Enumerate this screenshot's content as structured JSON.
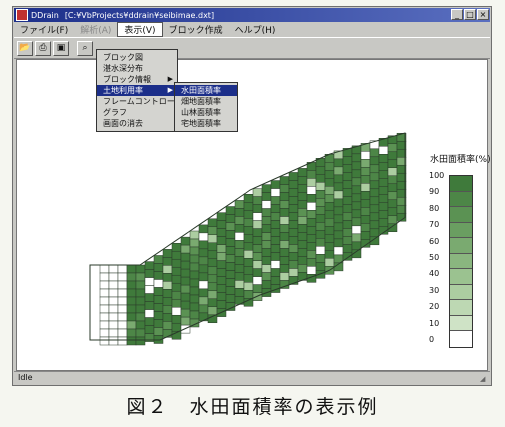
{
  "window": {
    "title_app": "DDrain",
    "title_path": "[C:¥VbProjects¥ddrain¥seibimae.dxt]",
    "controls": [
      "_",
      "□",
      "×"
    ]
  },
  "menubar": [
    {
      "label": "ファイル(F)",
      "state": "normal"
    },
    {
      "label": "解析(A)",
      "state": "dim"
    },
    {
      "label": "表示(V)",
      "state": "open"
    },
    {
      "label": "ブロック作成",
      "state": "normal"
    },
    {
      "label": "ヘルプ(H)",
      "state": "normal"
    }
  ],
  "toolbar": {
    "icons": [
      "open-folder-icon",
      "print-icon",
      "print-preview-icon",
      "zoom-icon"
    ]
  },
  "view_menu": {
    "items": [
      {
        "label": "ブロック図",
        "submenu": false
      },
      {
        "label": "湛水深分布",
        "submenu": false
      },
      {
        "label": "ブロック情報",
        "submenu": true
      },
      {
        "label": "土地利用率",
        "submenu": true,
        "selected": true
      },
      {
        "label": "フレームコントロール",
        "submenu": false
      },
      {
        "label": "グラフ",
        "submenu": false
      },
      {
        "label": "画面の消去",
        "submenu": false
      }
    ]
  },
  "landuse_submenu": {
    "items": [
      {
        "label": "水田面積率",
        "selected": true
      },
      {
        "label": "畑地面積率"
      },
      {
        "label": "山林面積率"
      },
      {
        "label": "宅地面積率"
      }
    ]
  },
  "legend": {
    "title": "水田面積率(%)",
    "labels": [
      "100",
      "90",
      "80",
      "70",
      "60",
      "50",
      "40",
      "30",
      "20",
      "10",
      "0"
    ],
    "colors": [
      "#3f7a3b",
      "#4d8647",
      "#5b9253",
      "#6a9e61",
      "#7aaa70",
      "#8ab67f",
      "#9bc290",
      "#accda1",
      "#bdd8b3",
      "#cfe3c6",
      "#ffffff"
    ]
  },
  "status": {
    "text": "Idle"
  },
  "caption": "図２　水田面積率の表示例",
  "colors": {
    "titlebar": "#1c2f8a",
    "map_outline": "#2a3a2a"
  }
}
